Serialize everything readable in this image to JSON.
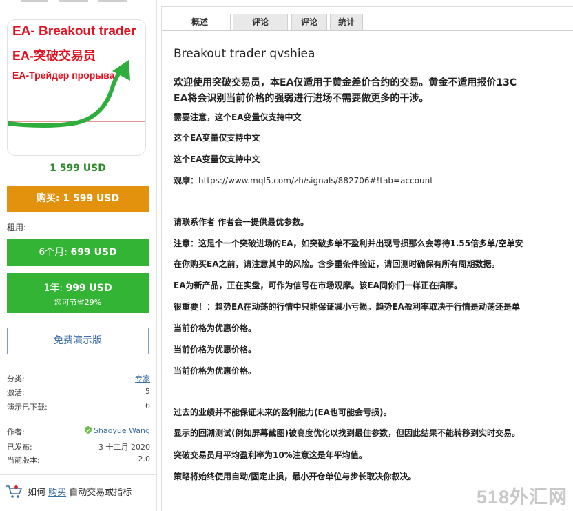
{
  "product_image": {
    "line1": "EA- Breakout trader",
    "line2": "EA-突破交易员",
    "line3": "EA-Трейдер прорыва"
  },
  "price": "1 599 USD",
  "buy_button": {
    "prefix": "购买: ",
    "amount": "1 599 USD"
  },
  "rent_label": "租用:",
  "rent_6m": {
    "prefix": "6个月: ",
    "amount": "699 USD"
  },
  "rent_1y": {
    "prefix": "1年: ",
    "amount": "999 USD",
    "save": "您可节省29%"
  },
  "demo_button": "免费演示版",
  "info": {
    "category": {
      "label": "分类:",
      "value": "专家"
    },
    "activations": {
      "label": "激活:",
      "value": "5"
    },
    "demo_downloads": {
      "label": "演示已下载:",
      "value": "6"
    },
    "author": {
      "label": "作者:",
      "value": "Shaoyue Wang"
    },
    "published": {
      "label": "已发布:",
      "value": "3 十二月 2020"
    },
    "version": {
      "label": "当前版本:",
      "value": "2.0"
    }
  },
  "how_to": {
    "prefix": "如何 ",
    "link": "购买",
    "suffix": " 自动交易或指标"
  },
  "tabs": [
    {
      "label": "概述"
    },
    {
      "label": "评论"
    },
    {
      "label": "评论"
    },
    {
      "label": "统计"
    }
  ],
  "content": {
    "title": "Breakout trader qvshiea",
    "intro1": "欢迎使用突破交易员，本EA仅适用于黄金差价合约的交易。黄金不适用报价13C",
    "intro2": "EA将会识别当前价格的强弱进行进场不需要做更多的干涉。",
    "note1": "需要注意，这个EA变量仅支持中文",
    "note2": "这个EA变量仅支持中文",
    "note3": "这个EA变量仅支持中文",
    "watch_label": "观摩：",
    "watch_url": "https://www.mql5.com/zh/signals/882706#!tab=account",
    "contact": "请联系作者 作者会一提供最优参数。",
    "warning": "注意：这是个一个突破进场的EA，如突破多单不盈利并出现亏损那么会等待1.55倍多单/空单安",
    "risk": "在你购买EA之前，请注意其中的风险。含多重条件验证，请回测时确保有所有周期数据。",
    "new_product": "EA为新产品，正在实盘，可作为信号在市场观摩。该EA同你们一样正在搞摩。",
    "important": "很重要！：趋势EA在动荡的行情中只能保证减小亏损。趋势EA盈利率取决于行情是动荡还是单",
    "discount1": "当前价格为优惠价格。",
    "discount2": "当前价格为优惠价格。",
    "discount3": "当前价格为优惠价格。",
    "past": "过去的业绩并不能保证未来的盈利能力(EA也可能会亏损)。",
    "backtest": "显示的回溯测试(例如屏幕截图)被高度优化以找到最佳参数，但因此结果不能转移到实时交易。",
    "monthly": "突破交易员月平均盈利率为10%注意这是年平均值。",
    "strategy": "策略将始终使用自动/固定止损，最小开仓单位与步长取决你叙决。"
  },
  "watermark": "518外汇网",
  "colors": {
    "buy": "#e3920d",
    "rent": "#34b434",
    "price": "#2c8c2c",
    "link": "#3c6ea7",
    "logo_red": "#e3101f"
  }
}
